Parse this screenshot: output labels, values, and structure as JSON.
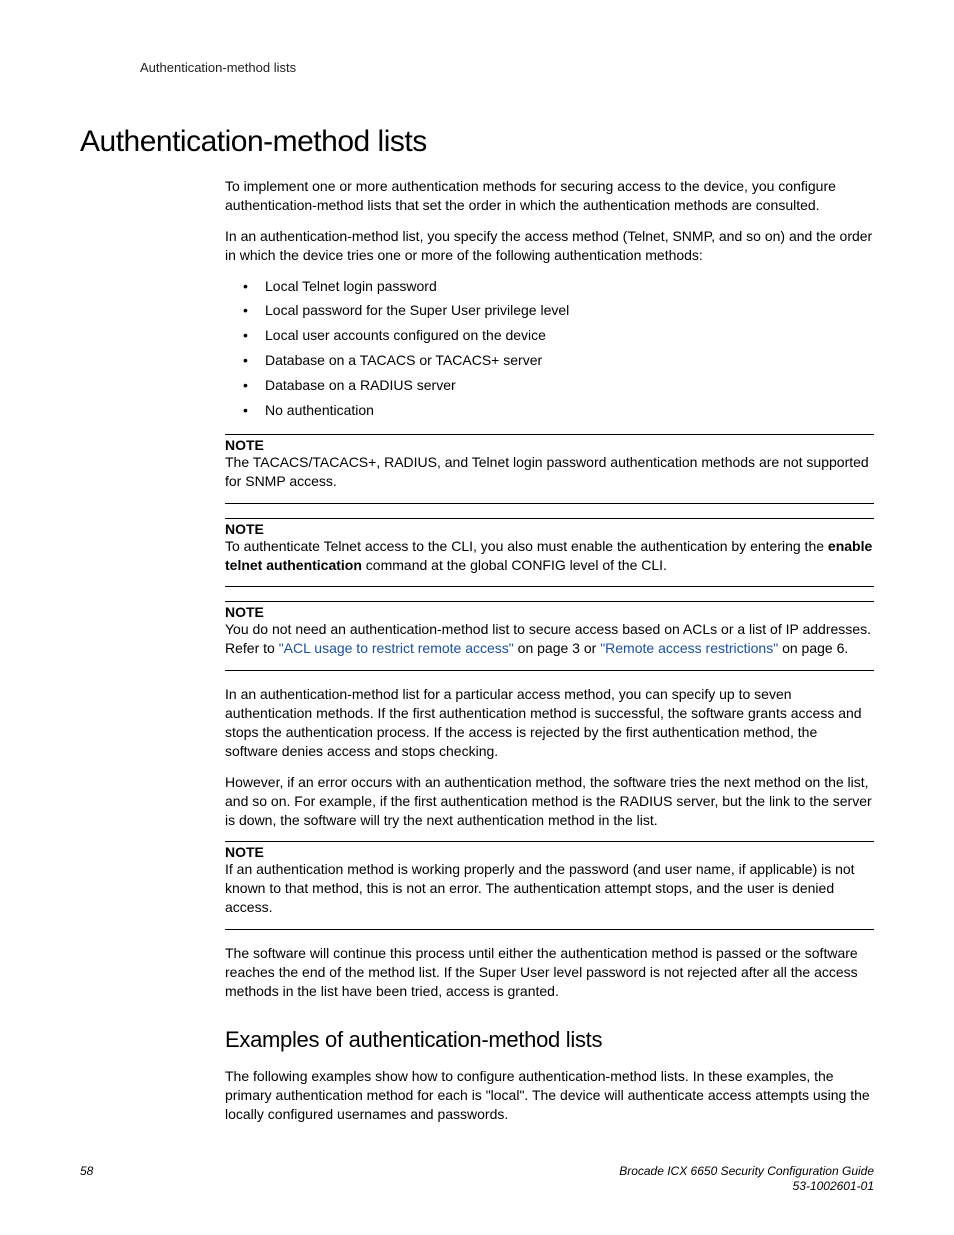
{
  "running_header": "Authentication-method lists",
  "heading": "Authentication-method lists",
  "intro_p1": "To implement one or more authentication methods for securing access to the device, you configure authentication-method lists that set the order in which the authentication methods are consulted.",
  "intro_p2": "In an authentication-method list, you specify the access method (Telnet,  SNMP, and so on) and the order in which the device tries one or more of the following authentication methods:",
  "bullets": {
    "b0": "Local Telnet login password",
    "b1": "Local password for the Super User privilege level",
    "b2": "Local user accounts configured on the device",
    "b3": "Database on a TACACS or TACACS+ server",
    "b4": "Database on a RADIUS server",
    "b5": "No authentication"
  },
  "note_label": "NOTE",
  "note1": "The TACACS/TACACS+, RADIUS, and Telnet login password authentication methods are not supported for SNMP access.",
  "note2_pre": "To authenticate Telnet access to the CLI, you also must enable the authentication by entering the ",
  "note2_bold": "enable telnet authentication",
  "note2_post": " command at the global CONFIG level of the CLI.",
  "note3_pre": "You do not need an authentication-method list to secure access based on ACLs or a list of IP addresses. Refer to ",
  "note3_link1": "\"ACL usage to restrict remote access\"",
  "note3_mid": " on page 3 or ",
  "note3_link2": "\"Remote access restrictions\"",
  "note3_post": " on page 6.",
  "para_after_notes_1": "In an authentication-method list for a particular access method, you can specify up to seven authentication methods. If the first authentication method is successful, the software grants access and stops the authentication process. If the access is rejected by the first authentication method, the software denies access and stops checking.",
  "para_after_notes_2": "However, if an error occurs with an authentication method, the software tries the next method on the list, and so on. For example, if the first authentication method is the RADIUS server, but the link to the server is down, the software will try the next authentication method in the list.",
  "note4": "If an authentication method is working properly and the password (and user name, if applicable) is not known to that method, this is not an error. The authentication attempt stops, and the user is denied access.",
  "para_after_note4": "The software will continue this process until either the authentication method is passed or the software reaches the end of the method list. If the Super User level password is not rejected after all the access methods in the list have been tried, access is granted.",
  "subheading": "Examples of authentication-method lists",
  "sub_p1": "The following examples show how to configure authentication-method lists. In these examples, the primary authentication method for each is \"local\". The device will authenticate access attempts using the locally configured usernames and passwords.",
  "footer": {
    "page_num": "58",
    "doc_title": "Brocade ICX 6650 Security Configuration Guide",
    "doc_id": "53-1002601-01"
  }
}
